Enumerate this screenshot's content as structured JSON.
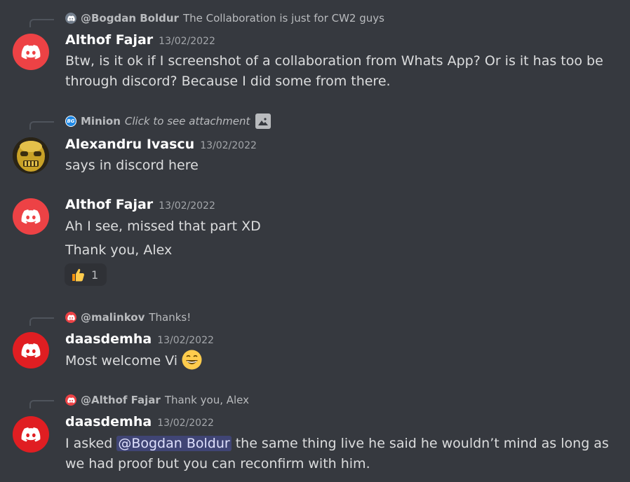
{
  "colors": {
    "background": "#36393f",
    "discord_red": "#ed4245",
    "mention_bg": "rgba(88,101,242,0.3)"
  },
  "messages": [
    {
      "reply": {
        "author": "@Bogdan Boldur",
        "text": "The Collaboration is just for CW2 guys",
        "avatar_icon": "discord-logo-gray"
      },
      "author": "Althof Fajar",
      "timestamp": "13/02/2022",
      "lines": [
        "Btw, is it ok if I screenshot of a collaboration from Whats App? Or is it has too be",
        "through discord? Because I did some from there."
      ]
    },
    {
      "reply": {
        "author": "Minion",
        "text": "Click to see attachment",
        "avatar_icon": "bg-logo",
        "attachment_icon": "image-icon"
      },
      "author": "Alexandru Ivascu",
      "timestamp": "13/02/2022",
      "lines": [
        "says in discord here"
      ]
    },
    {
      "author": "Althof Fajar",
      "timestamp": "13/02/2022",
      "lines": [
        "Ah I see, missed that part XD"
      ],
      "followup": "Thank you, Alex",
      "reaction": {
        "emoji": "thumbs-up",
        "count": "1"
      }
    },
    {
      "reply": {
        "author": "@malinkov",
        "text": "Thanks!",
        "avatar_icon": "discord-logo-red"
      },
      "author": "daasdemha",
      "timestamp": "13/02/2022",
      "text": "Most welcome Vi",
      "emoji": "grinning-face"
    },
    {
      "reply": {
        "author": "@Althof Fajar",
        "text": "Thank you, Alex",
        "avatar_icon": "discord-logo-red"
      },
      "author": "daasdemha",
      "timestamp": "13/02/2022",
      "pre_mention": "I asked ",
      "mention": "@Bogdan Boldur",
      "post_mention": " the same thing live he said he wouldn’t mind as long as",
      "line2": "we had proof but you can reconfirm with him."
    }
  ]
}
